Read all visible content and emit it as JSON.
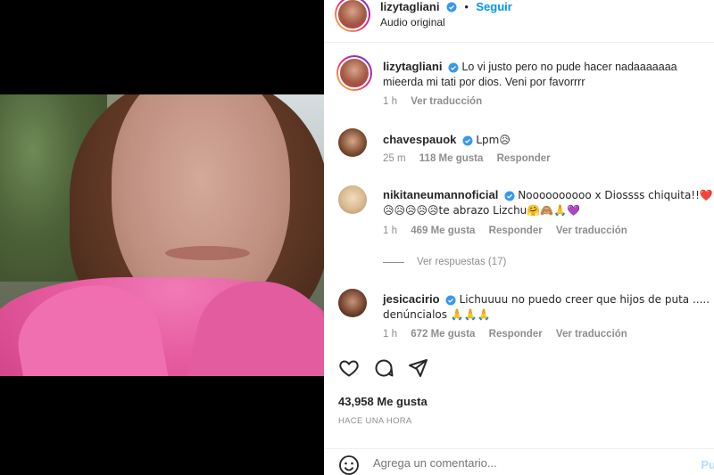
{
  "post": {
    "author": "lizytagliani",
    "follow_label": "Seguir",
    "audio": "Audio original"
  },
  "caption": {
    "user": "lizytagliani",
    "text": "Lo vi justo pero no pude hacer nadaaaaaaa mieerda mi tati por dios. Veni por favorrrr",
    "time": "1 h",
    "translate": "Ver traducción"
  },
  "comments": [
    {
      "user": "chavespauok",
      "text": "Lpm😥",
      "time": "25 m",
      "likes": "118 Me gusta",
      "reply": "Responder"
    },
    {
      "user": "nikitaneumannoficial",
      "text": "Noooooooooo x Diossss chiquita!!❤️😥😥😥😥😥te abrazo Lizchu🤗🙈🙏💜",
      "time": "1 h",
      "likes": "469 Me gusta",
      "reply": "Responder",
      "translate": "Ver traducción",
      "view_replies": "Ver respuestas (17)"
    },
    {
      "user": "jesicacirio",
      "text": "Lichuuuu no puedo creer que hijos de puta ..... denúncialos 🙏🙏🙏",
      "time": "1 h",
      "likes": "672 Me gusta",
      "reply": "Responder",
      "translate": "Ver traducción"
    }
  ],
  "stats": {
    "likes": "43,958 Me gusta",
    "posted": "HACE UNA HORA"
  },
  "composer": {
    "placeholder": "Agrega un comentario...",
    "publish": "Pu"
  },
  "colors": {
    "accent": "#0095f6",
    "verified": "#3897f0",
    "muted": "#8e8e8e",
    "robe": "#e65a9f"
  },
  "icons": [
    "mute-icon",
    "heart-icon",
    "comment-icon",
    "share-icon",
    "emoji-icon",
    "verified-badge-icon"
  ]
}
